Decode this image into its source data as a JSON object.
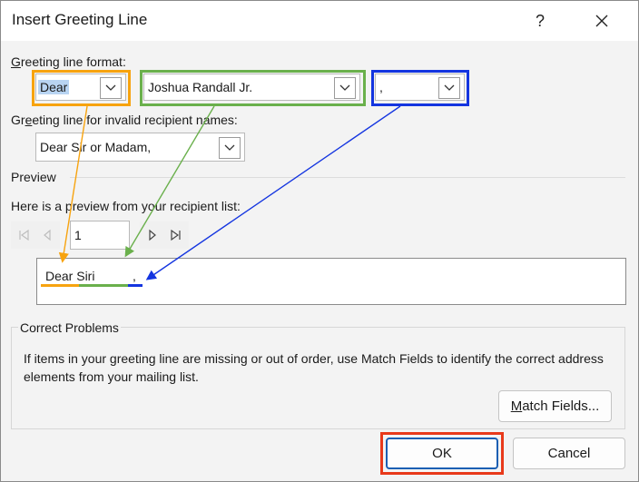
{
  "window": {
    "title": "Insert Greeting Line",
    "help_glyph": "?",
    "close_glyph": "✕"
  },
  "format_section": {
    "label_prefix": "G",
    "label_rest": "reeting line format:",
    "salutation": {
      "value": "Dear",
      "selected_text": true,
      "highlight_color": "#f7a30f"
    },
    "name_format": {
      "value": "Joshua Randall Jr.",
      "highlight_color": "#6ab04c"
    },
    "punctuation": {
      "value": ",",
      "highlight_color": "#1435e0"
    }
  },
  "invalid_section": {
    "label_prefix": "Gr",
    "label_mn": "e",
    "label_rest": "eting line for invalid recipient names:",
    "value": "Dear Sir or Madam,"
  },
  "preview": {
    "header": "Preview",
    "description": "Here is a preview from your recipient list:",
    "record_number": "1",
    "preview_text": "Dear Siri",
    "trailing_char": ","
  },
  "problems": {
    "header": "Correct Problems",
    "text": "If items in your greeting line are missing or out of order, use Match Fields to identify the correct address elements from your mailing list.",
    "match_button_prefix": "M",
    "match_button_rest": "atch Fields..."
  },
  "footer": {
    "ok_label": "OK",
    "cancel_label": "Cancel",
    "ok_highlight_color": "#e8391a"
  }
}
